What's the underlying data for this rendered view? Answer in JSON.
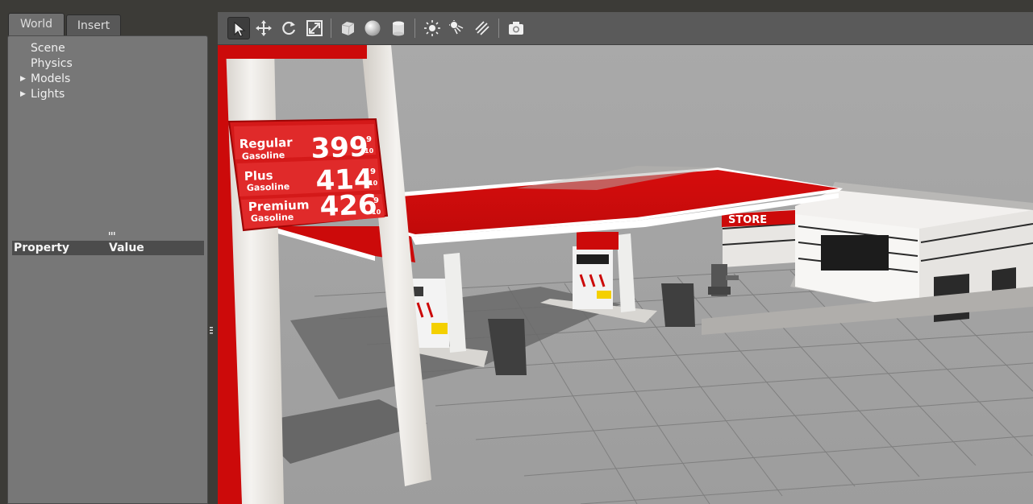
{
  "tabs": {
    "world": "World",
    "insert": "Insert"
  },
  "tree": {
    "items": [
      {
        "label": "Scene",
        "expandable": false
      },
      {
        "label": "Physics",
        "expandable": false
      },
      {
        "label": "Models",
        "expandable": true
      },
      {
        "label": "Lights",
        "expandable": true
      }
    ]
  },
  "properties": {
    "col_property": "Property",
    "col_value": "Value"
  },
  "toolbar": {
    "tools": [
      "select-arrow-icon",
      "translate-icon",
      "rotate-icon",
      "scale-icon",
      "box-icon",
      "sphere-icon",
      "cylinder-icon",
      "point-light-icon",
      "spot-light-icon",
      "directional-light-icon",
      "screenshot-icon"
    ]
  },
  "scene": {
    "price_sign": {
      "rows": [
        {
          "grade": "Regular",
          "type": "Gasoline",
          "price": "399",
          "frac_top": "9",
          "frac_bottom": "10"
        },
        {
          "grade": "Plus",
          "type": "Gasoline",
          "price": "414",
          "frac_top": "9",
          "frac_bottom": "10"
        },
        {
          "grade": "Premium",
          "type": "Gasoline",
          "price": "426",
          "frac_top": "9",
          "frac_bottom": "10"
        }
      ]
    },
    "store_sign": "STORE",
    "colors": {
      "brand_red": "#cc0a0a",
      "ground": "#9b9b9b",
      "sky": "#a6a6a6"
    }
  }
}
